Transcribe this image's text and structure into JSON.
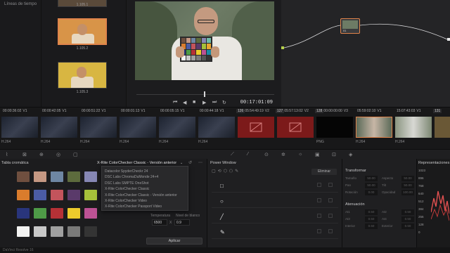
{
  "gallery": {
    "title": "Líneas de tiempo",
    "stills": [
      {
        "label": "1.105.1",
        "selected": false
      },
      {
        "label": "1.105.2",
        "selected": true
      },
      {
        "label": "1.105.3",
        "selected": false
      }
    ]
  },
  "viewer": {
    "timecode": "00:17:01:09",
    "chart_colors": [
      "#6f4f3f",
      "#c59883",
      "#6e86a3",
      "#5d6b3d",
      "#8687b4",
      "#6dbba9",
      "#da7c2c",
      "#4b5ca5",
      "#c3545c",
      "#5a3a6a",
      "#a5c13a",
      "#e8a531",
      "#29357c",
      "#4e9b47",
      "#b63136",
      "#eccb2c",
      "#bd5294",
      "#1a8aa5",
      "#f3f3f2",
      "#c8c8c8",
      "#a0a0a0",
      "#7a7a79",
      "#555555",
      "#343434"
    ]
  },
  "nodes": {
    "node_number": "01"
  },
  "timeline": {
    "clips": [
      {
        "num": "",
        "tc": "00:00:36:02",
        "track": "V1",
        "codec": "H.264",
        "kind": "dark"
      },
      {
        "num": "",
        "tc": "00:00:42:05",
        "track": "V1",
        "codec": "H.264",
        "kind": "dark"
      },
      {
        "num": "",
        "tc": "00:00:51:22",
        "track": "V1",
        "codec": "H.264",
        "kind": "dark"
      },
      {
        "num": "",
        "tc": "00:00:01:13",
        "track": "V1",
        "codec": "H.264",
        "kind": "dark"
      },
      {
        "num": "",
        "tc": "00:00:05:15",
        "track": "V1",
        "codec": "H.264",
        "kind": "dark"
      },
      {
        "num": "",
        "tc": "00:00:44:18",
        "track": "V1",
        "codec": "H.264",
        "kind": "dark"
      },
      {
        "num": "126",
        "tc": "05:54:49:19",
        "track": "V2",
        "codec": "",
        "kind": "red"
      },
      {
        "num": "127",
        "tc": "05:57:13:02",
        "track": "V2",
        "codec": "",
        "kind": "red"
      },
      {
        "num": "128",
        "tc": "00:00:00:00",
        "track": "V3",
        "codec": "PNG",
        "kind": "black"
      },
      {
        "num": "",
        "tc": "05:59:02:10",
        "track": "V1",
        "codec": "H.264",
        "kind": "person",
        "selected": true
      },
      {
        "num": "",
        "tc": "15:07:43:03",
        "track": "V1",
        "codec": "H.264",
        "kind": "person2"
      },
      {
        "num": "131",
        "tc": "",
        "track": "",
        "codec": "",
        "kind": "partial"
      }
    ]
  },
  "color_chart": {
    "title": "Tabla cromática",
    "selected_chart": "X-Rite ColorChecker Classic - Versión anterior",
    "options": [
      "Datacolor SpyderCheckr 24",
      "DSC Labs ChromaDuMonde 24+4",
      "DSC Labs SMPTE OneShot",
      "X-Rite ColorChecker Classic",
      "X-Rite ColorChecker Classic - Versión anterior",
      "X-Rite ColorChecker Video",
      "X-Rite ColorChecker Passport Video"
    ],
    "swatches": [
      "#6f4f3f",
      "#c59883",
      "#6e86a3",
      "#5d6b3d",
      "#8687b4",
      "#da7c2c",
      "#4b5ca5",
      "#c3545c",
      "#5a3a6a",
      "#a5c13a",
      "#29357c",
      "#4e9b47",
      "#b63136",
      "#eccb2c",
      "#bd5294",
      "#f3f3f2",
      "#c8c8c8",
      "#a0a0a0",
      "#7a7a79",
      "#343434"
    ],
    "temperature_label": "Temperatura",
    "temperature_value": "6500",
    "white_level_label": "Nivel de blanco",
    "white_level_value": "0.9",
    "x_label": "X",
    "apply_label": "Aplicar"
  },
  "power_window": {
    "title": "Power Window",
    "delete_label": "Eliminar",
    "shapes": [
      "square-icon",
      "circle-icon",
      "line-icon",
      "pen-icon"
    ]
  },
  "transform": {
    "title": "Transformar",
    "fields": [
      {
        "label": "Tamaño",
        "value": "50.00"
      },
      {
        "label": "Aspecto",
        "value": "50.00"
      },
      {
        "label": "Pan",
        "value": "50.00"
      },
      {
        "label": "Tilt",
        "value": "50.00"
      },
      {
        "label": "Rotación",
        "value": "0.00"
      },
      {
        "label": "Opacidad",
        "value": "100.00"
      }
    ],
    "softness_title": "Atenuación",
    "softness_fields": [
      {
        "label": "At1",
        "value": "0.50"
      },
      {
        "label": "At2",
        "value": "0.50"
      },
      {
        "label": "At3",
        "value": "0.50"
      },
      {
        "label": "At4",
        "value": "0.50"
      },
      {
        "label": "Interior",
        "value": "0.50"
      },
      {
        "label": "Exterior",
        "value": "0.50"
      }
    ]
  },
  "scopes": {
    "title": "Representaciones",
    "axis": [
      "1023",
      "896",
      "768",
      "640",
      "512",
      "384",
      "256",
      "128",
      "0"
    ]
  },
  "app": {
    "name": "DaVinci Resolve 16"
  }
}
